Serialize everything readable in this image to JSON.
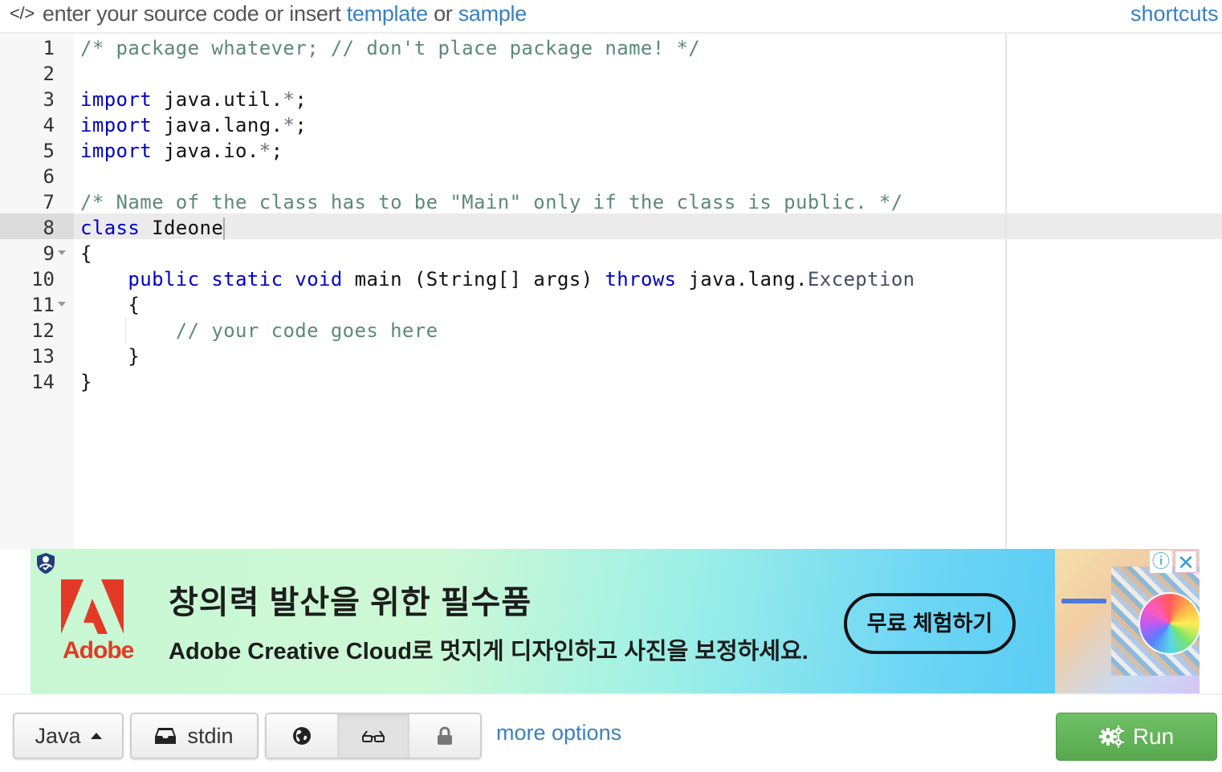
{
  "topbar": {
    "code_icon": "</>",
    "hint_prefix": "enter your source code or insert",
    "template_link": "template",
    "or_text": "or",
    "sample_link": "sample",
    "shortcuts_link": "shortcuts"
  },
  "editor": {
    "active_line": 8,
    "lines": [
      {
        "n": "1",
        "fold": false,
        "tokens": [
          {
            "t": "cm",
            "v": "/* package whatever; // don't place package name! */"
          }
        ]
      },
      {
        "n": "2",
        "fold": false,
        "tokens": []
      },
      {
        "n": "3",
        "fold": false,
        "tokens": [
          {
            "t": "kw",
            "v": "import"
          },
          {
            "t": "",
            "v": " java.util."
          },
          {
            "t": "op",
            "v": "*"
          },
          {
            "t": "",
            "v": ";"
          }
        ]
      },
      {
        "n": "4",
        "fold": false,
        "tokens": [
          {
            "t": "kw",
            "v": "import"
          },
          {
            "t": "",
            "v": " java.lang."
          },
          {
            "t": "op",
            "v": "*"
          },
          {
            "t": "",
            "v": ";"
          }
        ]
      },
      {
        "n": "5",
        "fold": false,
        "tokens": [
          {
            "t": "kw",
            "v": "import"
          },
          {
            "t": "",
            "v": " java.io."
          },
          {
            "t": "op",
            "v": "*"
          },
          {
            "t": "",
            "v": ";"
          }
        ]
      },
      {
        "n": "6",
        "fold": false,
        "tokens": []
      },
      {
        "n": "7",
        "fold": false,
        "tokens": [
          {
            "t": "cm",
            "v": "/* Name of the class has to be \"Main\" only if the class is public. */"
          }
        ]
      },
      {
        "n": "8",
        "fold": false,
        "tokens": [
          {
            "t": "kw",
            "v": "class"
          },
          {
            "t": "",
            "v": " Ideone"
          },
          {
            "t": "cursor",
            "v": ""
          }
        ]
      },
      {
        "n": "9",
        "fold": true,
        "tokens": [
          {
            "t": "",
            "v": "{"
          }
        ]
      },
      {
        "n": "10",
        "fold": false,
        "tokens": [
          {
            "t": "",
            "v": "    "
          },
          {
            "t": "kw",
            "v": "public"
          },
          {
            "t": "",
            "v": " "
          },
          {
            "t": "kw",
            "v": "static"
          },
          {
            "t": "",
            "v": " "
          },
          {
            "t": "kw",
            "v": "void"
          },
          {
            "t": "",
            "v": " main (String[] args) "
          },
          {
            "t": "kw",
            "v": "throws"
          },
          {
            "t": "",
            "v": " java.lang."
          },
          {
            "t": "ty",
            "v": "Exception"
          }
        ]
      },
      {
        "n": "11",
        "fold": true,
        "tokens": [
          {
            "t": "",
            "v": "    {"
          }
        ]
      },
      {
        "n": "12",
        "fold": false,
        "tokens": [
          {
            "t": "",
            "v": "        "
          },
          {
            "t": "cm",
            "v": "// your code goes here"
          }
        ]
      },
      {
        "n": "13",
        "fold": false,
        "tokens": [
          {
            "t": "",
            "v": "    }"
          }
        ]
      },
      {
        "n": "14",
        "fold": false,
        "tokens": [
          {
            "t": "",
            "v": "}"
          }
        ]
      }
    ]
  },
  "ad": {
    "brand": "Adobe",
    "headline": "창의력 발산을 위한 필수품",
    "subline": "Adobe Creative Cloud로 멋지게 디자인하고 사진을 보정하세요.",
    "cta": "무료 체험하기",
    "info_icon": "ⓘ",
    "close_icon": "✕",
    "brand_color": "#e23a26"
  },
  "toolbar": {
    "language": "Java",
    "stdin_label": "stdin",
    "visibility_selected": "secret",
    "more_options": "more options",
    "run_label": "Run",
    "run_color": "#5cb153",
    "link_color": "#3a80c1"
  }
}
